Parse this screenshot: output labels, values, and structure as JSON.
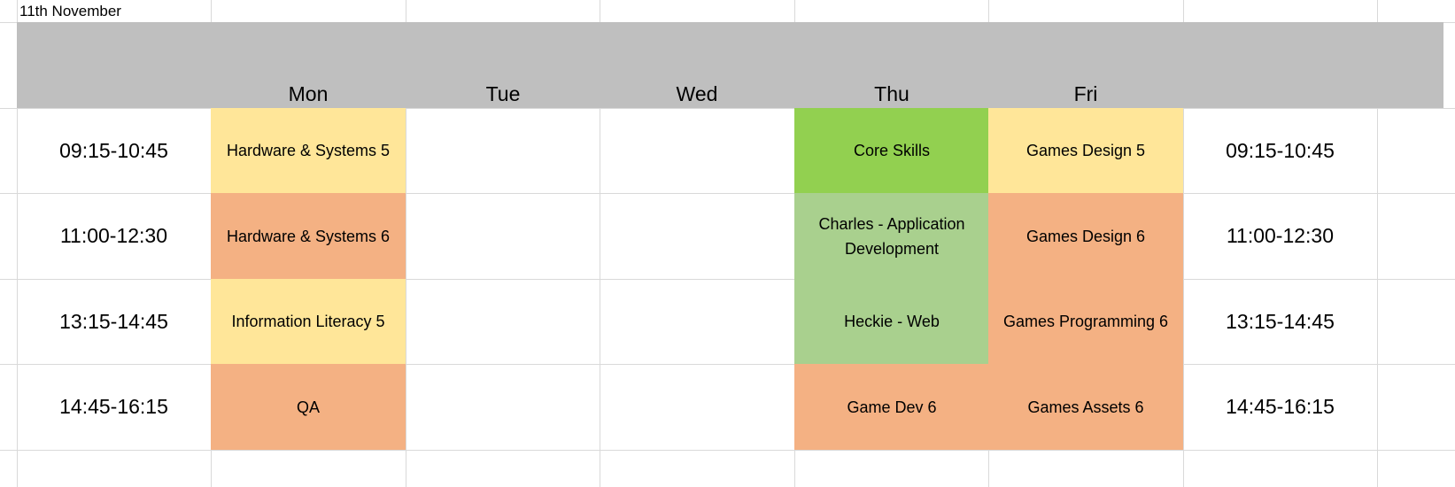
{
  "sheet": {
    "date_label": "11th November",
    "days": [
      "Mon",
      "Tue",
      "Wed",
      "Thu",
      "Fri"
    ],
    "times_left": [
      "09:15-10:45",
      "11:00-12:30",
      "13:15-14:45",
      "14:45-16:15"
    ],
    "times_right": [
      "09:15-10:45",
      "11:00-12:30",
      "13:15-14:45",
      "14:45-16:15"
    ],
    "mon": [
      "Hardware & Systems 5",
      "Hardware & Systems 6",
      "Information Literacy 5",
      "QA"
    ],
    "thu": [
      "Core Skills",
      "Charles - Application Development",
      "Heckie - Web",
      "Game Dev 6"
    ],
    "fri": [
      "Games Design 5",
      "Games Design 6",
      "Games Programming 6",
      "Games Assets 6"
    ]
  },
  "colors": {
    "header_band": "#bfbfbf",
    "level5_yellow": "#ffe699",
    "level6_orange": "#f4b183",
    "core_green": "#92d050",
    "tutor_green": "#a9d08e",
    "gridline": "#d9d9d9"
  }
}
